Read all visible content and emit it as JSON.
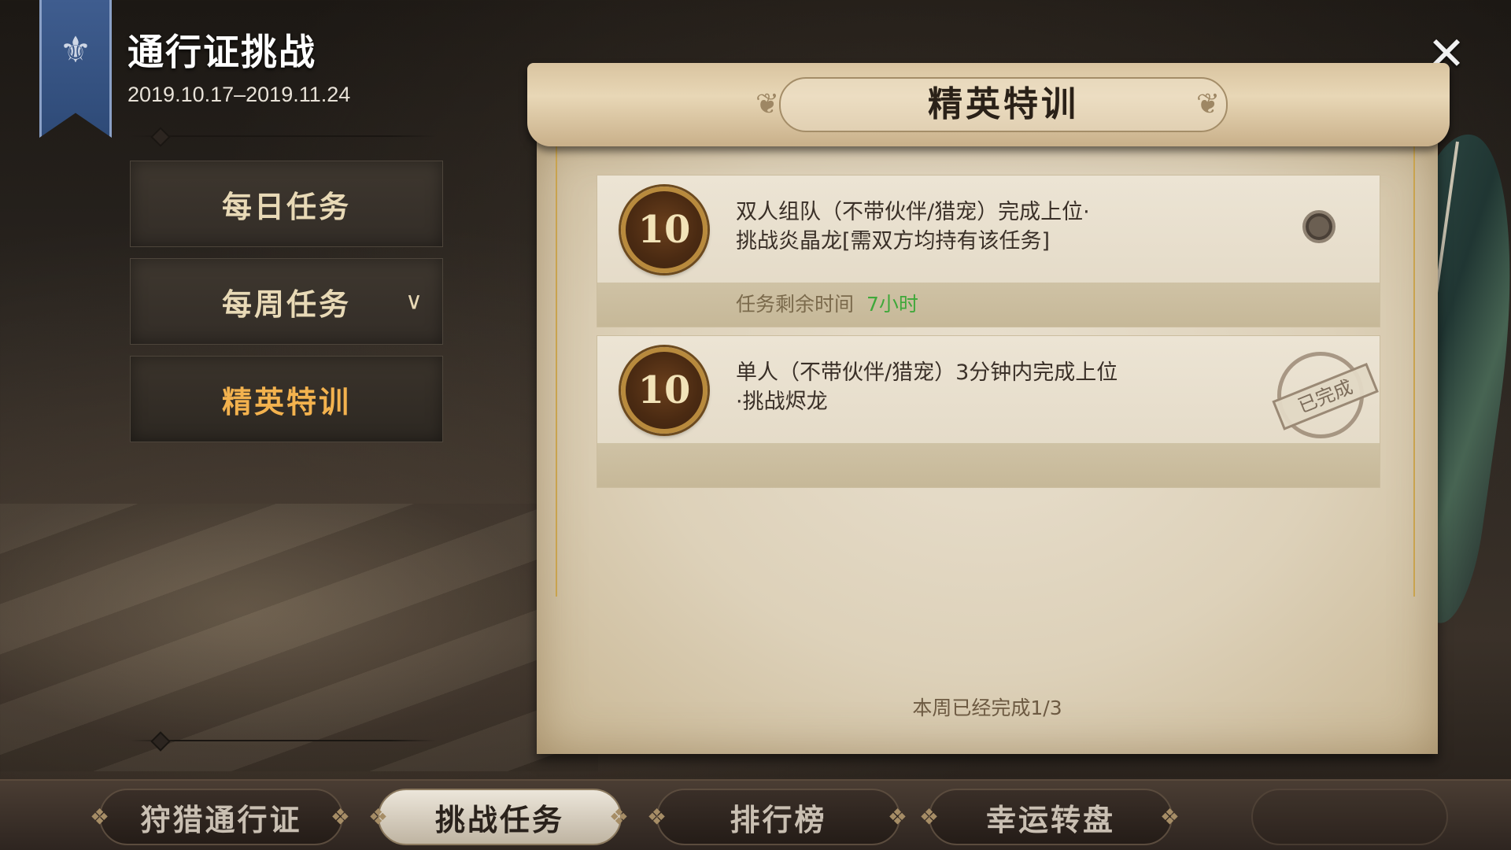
{
  "header": {
    "title": "通行证挑战",
    "date_range": "2019.10.17–2019.11.24"
  },
  "sidebar": {
    "items": [
      {
        "label": "每日任务",
        "active": false
      },
      {
        "label": "每周任务",
        "active": false,
        "has_dropdown": true
      },
      {
        "label": "精英特训",
        "active": true
      }
    ],
    "dropdown_icon": "chevron-down-icon"
  },
  "panel": {
    "title": "精英特训",
    "tasks": [
      {
        "reward": "10",
        "description_line1": "双人组队（不带伙伴/猎宠）完成上位·",
        "description_line2": "挑战炎晶龙[需双方均持有该任务]",
        "remaining_label": "任务剩余时间",
        "remaining_value": "7小时",
        "status": "in_progress"
      },
      {
        "reward": "10",
        "description_line1": "单人（不带伙伴/猎宠）3分钟内完成上位",
        "description_line2": "·挑战烬龙",
        "status_label": "已完成",
        "status": "completed"
      }
    ],
    "weekly_progress": "本周已经完成1/3"
  },
  "tabs": [
    {
      "label": "狩猎通行证",
      "active": false
    },
    {
      "label": "挑战任务",
      "active": true
    },
    {
      "label": "排行榜",
      "active": false
    },
    {
      "label": "幸运转盘",
      "active": false
    }
  ],
  "colors": {
    "active_sidebar_text": "#f3b24e",
    "remaining_time": "#3fa83a",
    "banner": "#3f5d8f"
  },
  "close_icon": "close-icon"
}
